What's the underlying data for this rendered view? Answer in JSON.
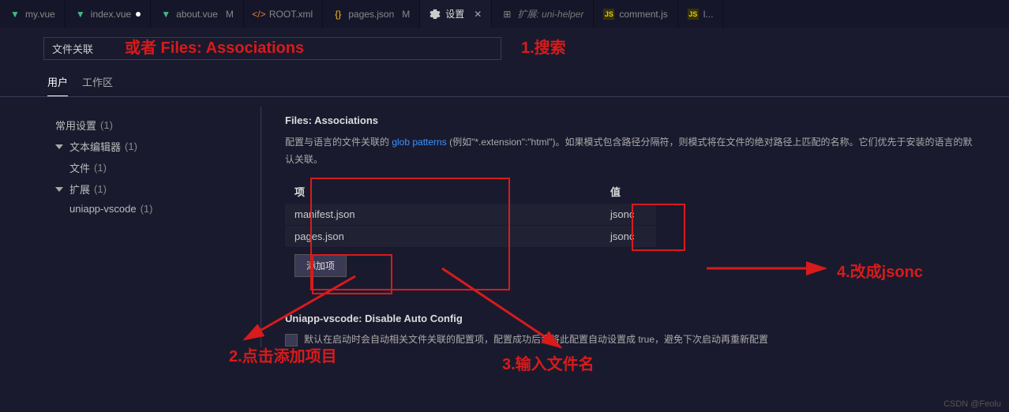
{
  "tabs": [
    {
      "name": "my.vue",
      "iconType": "vue",
      "modified": false
    },
    {
      "name": "index.vue",
      "iconType": "vue",
      "modified": true,
      "dot": true
    },
    {
      "name": "about.vue",
      "iconType": "vue",
      "modified": false,
      "mod_label": "M"
    },
    {
      "name": "ROOT.xml",
      "iconType": "xml",
      "modified": false
    },
    {
      "name": "pages.json",
      "iconType": "json",
      "modified": false,
      "mod_label": "M"
    },
    {
      "name": "设置",
      "iconType": "gear",
      "active": true
    },
    {
      "name": "扩展: uni-helper",
      "iconType": "ext",
      "modified": false
    },
    {
      "name": "comment.js",
      "iconType": "js",
      "modified": false
    },
    {
      "name": "l...",
      "iconType": "js",
      "modified": false
    }
  ],
  "search": {
    "value": "文件关联"
  },
  "scope": {
    "user": "用户",
    "workspace": "工作区"
  },
  "sidebar": {
    "items": [
      {
        "label": "常用设置",
        "count": "(1)",
        "indent": 0
      },
      {
        "label": "文本编辑器",
        "count": "(1)",
        "indent": 0,
        "expandable": true
      },
      {
        "label": "文件",
        "count": "(1)",
        "indent": 1
      },
      {
        "label": "扩展",
        "count": "(1)",
        "indent": 0,
        "expandable": true
      },
      {
        "label": "uniapp-vscode",
        "count": "(1)",
        "indent": 1
      }
    ]
  },
  "setting1": {
    "title": "Files: Associations",
    "desc_pre": "配置与语言的文件关联的 ",
    "desc_link": "glob patterns",
    "desc_post": "(例如\"*.extension\":\"html\")。如果模式包含路径分隔符，则模式将在文件的绝对路径上匹配的名称。它们优先于安装的语言的默认关联。",
    "col_key": "项",
    "col_val": "值",
    "rows": [
      {
        "key": "manifest.json",
        "val": "jsonc"
      },
      {
        "key": "pages.json",
        "val": "jsonc"
      }
    ],
    "add_label": "添加项"
  },
  "setting2": {
    "title": "Uniapp-vscode: Disable Auto Config",
    "desc": "默认在启动时会自动相关文件关联的配置项，配置成功后会将此配置自动设置成 true，避免下次启动再重新配置"
  },
  "annotations": {
    "a1": "或者 Files: Associations",
    "a2": "1.搜索",
    "a3": "2.点击添加项目",
    "a4": "3.输入文件名",
    "a5": "4.改成jsonc"
  },
  "watermark": "CSDN @Feolu"
}
